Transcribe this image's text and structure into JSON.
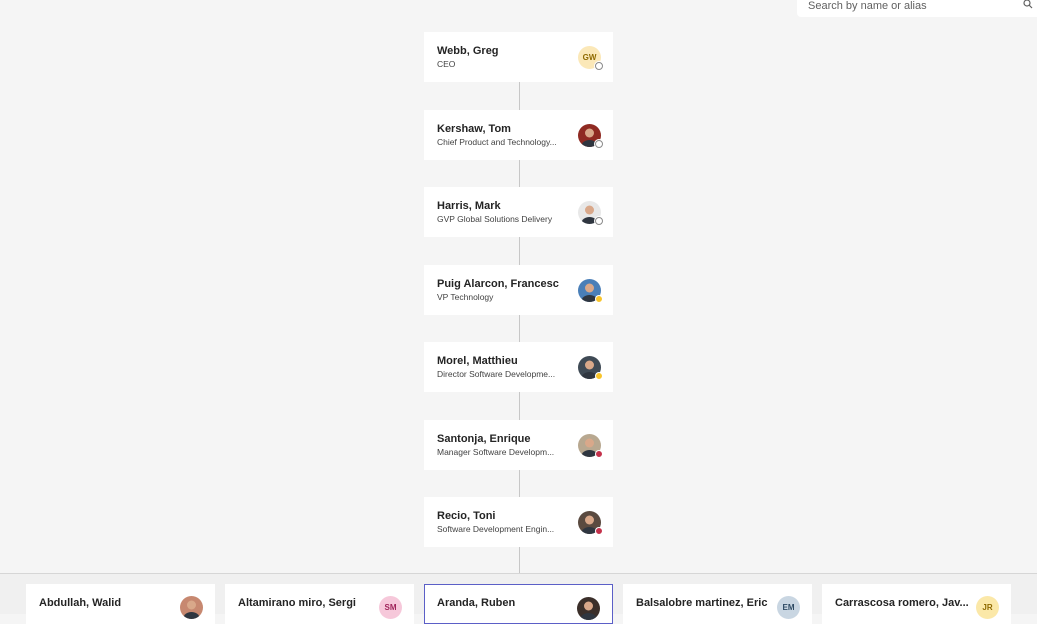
{
  "search": {
    "placeholder": "Search by name or alias"
  },
  "chain": [
    {
      "name": "Webb, Greg",
      "title": "CEO",
      "avatar": {
        "initials": "GW",
        "bg": "#fbe8b8",
        "fg": "#8f6a00",
        "photo": false
      },
      "presence": "offline"
    },
    {
      "name": "Kershaw, Tom",
      "title": "Chief Product and Technology...",
      "avatar": {
        "initials": "",
        "bg": "#8f2a22",
        "fg": "#ffffff",
        "photo": true
      },
      "presence": "offline"
    },
    {
      "name": "Harris, Mark",
      "title": "GVP Global Solutions Delivery",
      "avatar": {
        "initials": "",
        "bg": "#e8e8e8",
        "fg": "#333333",
        "photo": true
      },
      "presence": "offline"
    },
    {
      "name": "Puig Alarcon, Francesc",
      "title": "VP Technology",
      "avatar": {
        "initials": "",
        "bg": "#4a7fb8",
        "fg": "#ffffff",
        "photo": true
      },
      "presence": "away"
    },
    {
      "name": "Morel, Matthieu",
      "title": "Director Software Developme...",
      "avatar": {
        "initials": "",
        "bg": "#3f4a55",
        "fg": "#ffffff",
        "photo": true
      },
      "presence": "away"
    },
    {
      "name": "Santonja, Enrique",
      "title": "Manager Software Developm...",
      "avatar": {
        "initials": "",
        "bg": "#b8a890",
        "fg": "#ffffff",
        "photo": true
      },
      "presence": "busy"
    },
    {
      "name": "Recio, Toni",
      "title": "Software Development Engin...",
      "avatar": {
        "initials": "",
        "bg": "#5a4a40",
        "fg": "#ffffff",
        "photo": true
      },
      "presence": "busy"
    }
  ],
  "reports": [
    {
      "name": "Abdullah, Walid",
      "avatar": {
        "initials": "",
        "bg": "#c78870",
        "fg": "#ffffff",
        "photo": true
      },
      "selected": false
    },
    {
      "name": "Altamirano miro, Sergi",
      "avatar": {
        "initials": "SM",
        "bg": "#f6c8da",
        "fg": "#a0245a",
        "photo": false
      },
      "selected": false
    },
    {
      "name": "Aranda, Ruben",
      "avatar": {
        "initials": "",
        "bg": "#3b2f2a",
        "fg": "#ffffff",
        "photo": true
      },
      "selected": true
    },
    {
      "name": "Balsalobre martinez, Eric",
      "avatar": {
        "initials": "EM",
        "bg": "#c9d6e2",
        "fg": "#2e4a63",
        "photo": false
      },
      "selected": false
    },
    {
      "name": "Carrascosa romero, Jav...",
      "avatar": {
        "initials": "JR",
        "bg": "#fbe8a8",
        "fg": "#8f6a00",
        "photo": false
      },
      "selected": false
    }
  ]
}
